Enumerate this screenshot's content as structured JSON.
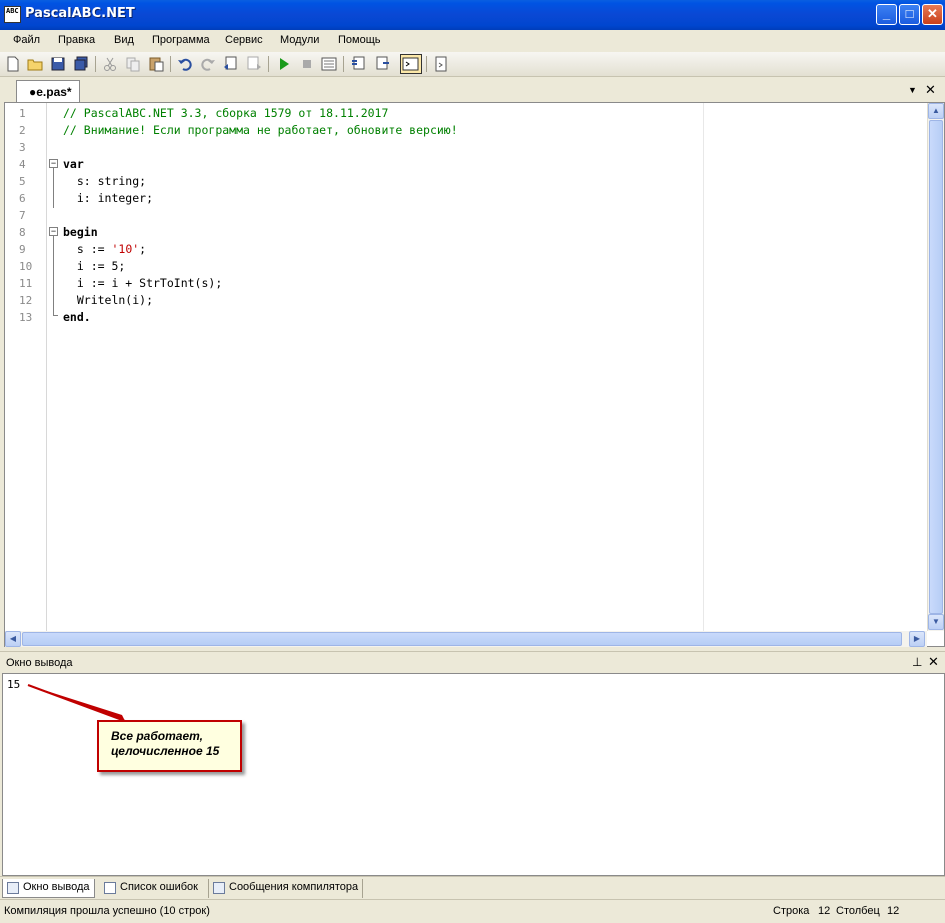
{
  "window": {
    "title": "PascalABC.NET",
    "icon_text": "AB\nC"
  },
  "menu": [
    "Файл",
    "Правка",
    "Вид",
    "Программа",
    "Сервис",
    "Модули",
    "Помощь"
  ],
  "tab": {
    "label": "●e.pas*"
  },
  "editor": {
    "line_numbers": [
      "1",
      "2",
      "3",
      "4",
      "5",
      "6",
      "7",
      "8",
      "9",
      "10",
      "11",
      "12",
      "13"
    ],
    "lines": [
      "// PascalABC.NET 3.3, сборка 1579 от 18.11.2017",
      "// Внимание! Если программа не работает, обновите версию!",
      "",
      "var",
      "  s: string;",
      "  i: integer;",
      "",
      "begin",
      "  s := '10';",
      "  i := 5;",
      "  i := i + StrToInt(s);",
      "  Writeln(i);",
      "end."
    ]
  },
  "output": {
    "title": "Окно вывода",
    "text": "15",
    "callout_line1": "Все работает,",
    "callout_line2": "целочисленное 15"
  },
  "bottom_tabs": [
    "Окно вывода",
    "Список ошибок",
    "Сообщения компилятора"
  ],
  "status": {
    "message": "Компиляция прошла успешно (10 строк)",
    "row_label": "Строка",
    "row_value": "12",
    "col_label": "Столбец",
    "col_value": "12"
  },
  "colors": {
    "comment": "#008000",
    "string": "#c00000",
    "callout_border": "#c00000",
    "title_bar": "#0054e3"
  }
}
